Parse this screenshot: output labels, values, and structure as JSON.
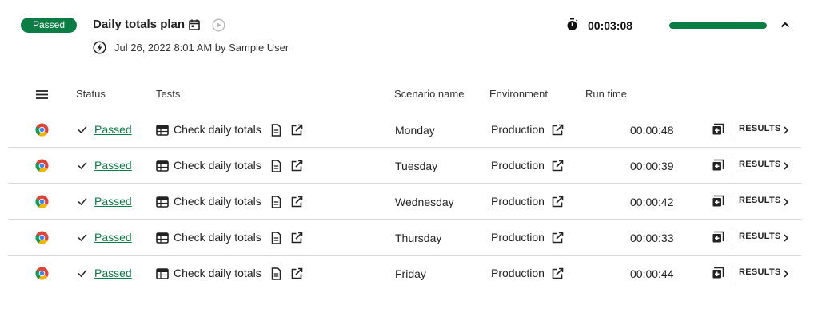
{
  "plan": {
    "status_badge": "Passed",
    "title": "Daily totals plan",
    "meta": "Jul 26, 2022 8:01 AM by Sample User",
    "timer": "00:03:08",
    "progress_fraction": 1.0,
    "status_color": "#0a7d45"
  },
  "table": {
    "headers": {
      "status": "Status",
      "tests": "Tests",
      "scenario": "Scenario name",
      "environment": "Environment",
      "runtime": "Run time"
    },
    "rows": [
      {
        "browser": "chrome-icon",
        "status": "Passed",
        "test": "Check daily totals",
        "scenario": "Monday",
        "environment": "Production",
        "runtime": "00:00:48",
        "results": "RESULTS"
      },
      {
        "browser": "chrome-icon",
        "status": "Passed",
        "test": "Check daily totals",
        "scenario": "Tuesday",
        "environment": "Production",
        "runtime": "00:00:39",
        "results": "RESULTS"
      },
      {
        "browser": "chrome-icon",
        "status": "Passed",
        "test": "Check daily totals",
        "scenario": "Wednesday",
        "environment": "Production",
        "runtime": "00:00:42",
        "results": "RESULTS"
      },
      {
        "browser": "chrome-icon",
        "status": "Passed",
        "test": "Check daily totals",
        "scenario": "Thursday",
        "environment": "Production",
        "runtime": "00:00:33",
        "results": "RESULTS"
      },
      {
        "browser": "chrome-icon",
        "status": "Passed",
        "test": "Check daily totals",
        "scenario": "Friday",
        "environment": "Production",
        "runtime": "00:00:44",
        "results": "RESULTS"
      }
    ]
  }
}
